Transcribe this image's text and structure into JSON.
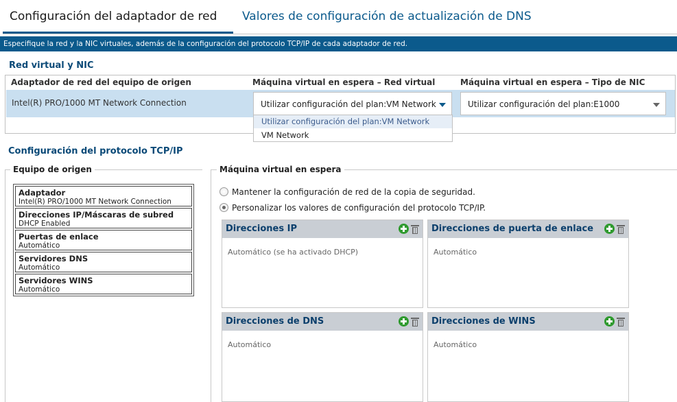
{
  "tabs": {
    "active": "Configuración del adaptador de red",
    "inactive": "Valores de configuración de actualización de DNS"
  },
  "info_bar": "Especifique la red y la NIC virtuales, además de la configuración del protocolo TCP/IP de cada adaptador de red.",
  "nic_section": {
    "title": "Red virtual y NIC",
    "headers": {
      "source": "Adaptador de red del equipo de origen",
      "network": "Máquina virtual en espera – Red virtual",
      "nic_type": "Máquina virtual en espera – Tipo de NIC"
    },
    "row": {
      "adapter": "Intel(R) PRO/1000 MT Network Connection",
      "network_value": "Utilizar configuración del plan:VM Network",
      "nic_type_value": "Utilizar configuración del plan:E1000"
    },
    "network_options": [
      "Utilizar configuración del plan:VM Network",
      "VM Network"
    ]
  },
  "tcpip_section": {
    "title": "Configuración del protocolo TCP/IP",
    "source_group": {
      "label": "Equipo de origen",
      "items": [
        {
          "title": "Adaptador",
          "value": "Intel(R) PRO/1000 MT Network Connection"
        },
        {
          "title": "Direcciones IP/Máscaras de subred",
          "value": "DHCP Enabled"
        },
        {
          "title": "Puertas de enlace",
          "value": "Automático"
        },
        {
          "title": "Servidores DNS",
          "value": "Automático"
        },
        {
          "title": "Servidores WINS",
          "value": "Automático"
        }
      ]
    },
    "standby_group": {
      "label": "Máquina virtual en espera",
      "radio_keep": "Mantener la configuración de red de la copia de seguridad.",
      "radio_custom": "Personalizar los valores de configuración del protocolo TCP/IP.",
      "selected": "custom",
      "panels": {
        "ip": {
          "title": "Direcciones IP",
          "body": "Automático (se ha activado DHCP)"
        },
        "gateway": {
          "title": "Direcciones de puerta de enlace",
          "body": "Automático"
        },
        "dns": {
          "title": "Direcciones de DNS",
          "body": "Automático"
        },
        "wins": {
          "title": "Direcciones de WINS",
          "body": "Automático"
        }
      }
    }
  }
}
